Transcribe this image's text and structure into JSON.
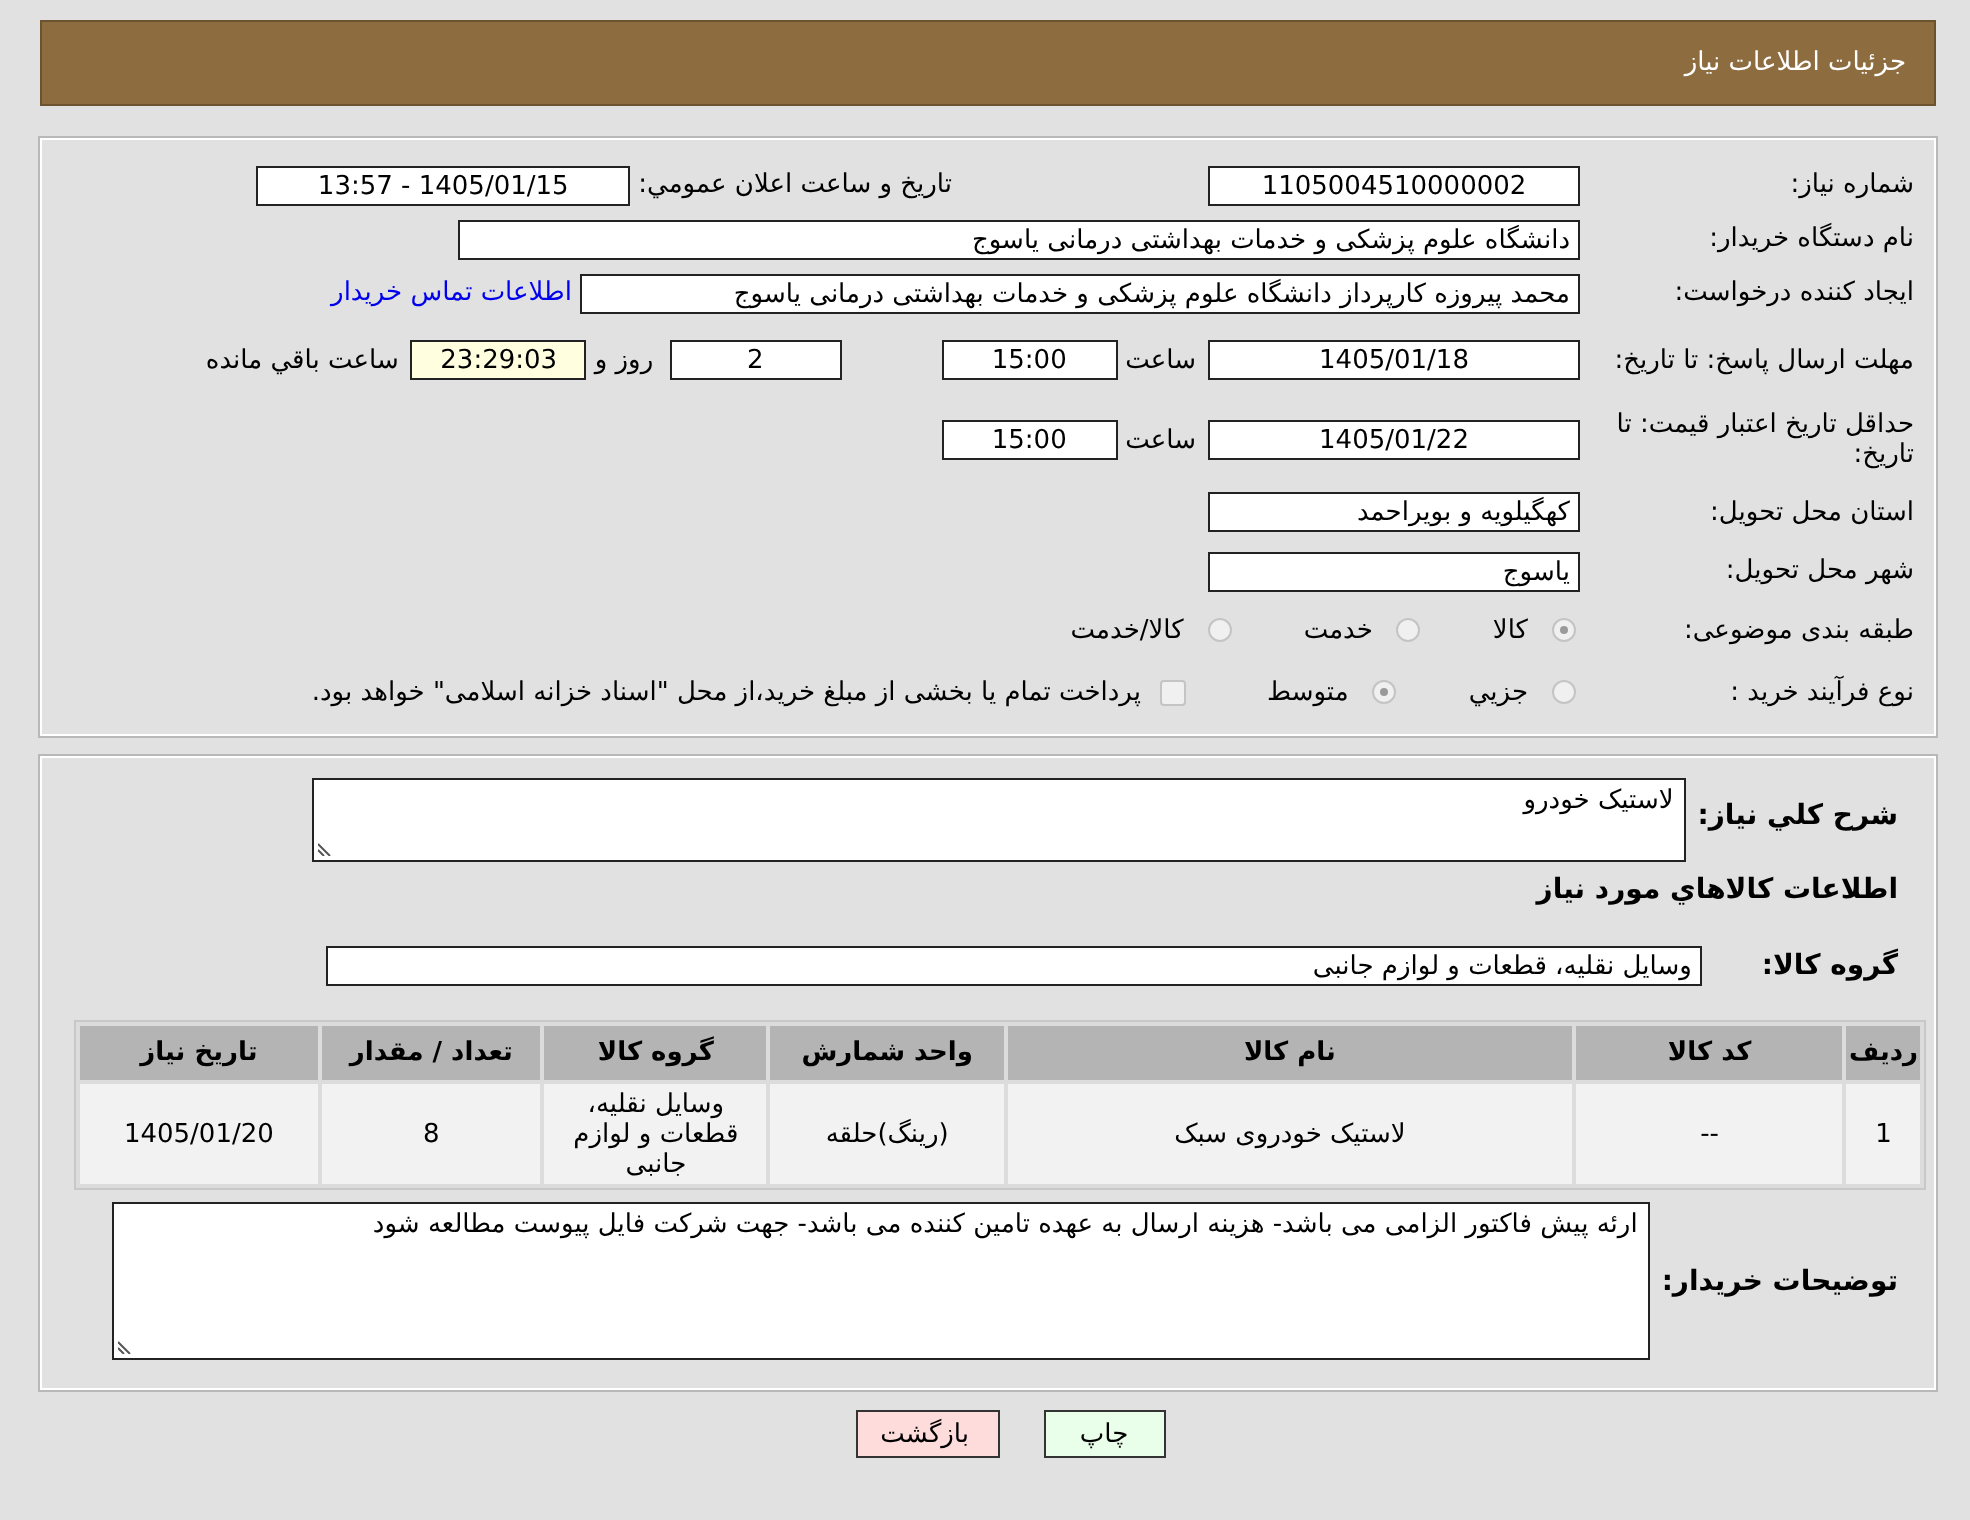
{
  "header": {
    "title": "جزئیات اطلاعات نیاز"
  },
  "need_number": {
    "label": "شماره نیاز:",
    "value": "1105004510000002"
  },
  "announce": {
    "label": "تاریخ و ساعت اعلان عمومي:",
    "value": "1405/01/15 - 13:57"
  },
  "buyer": {
    "label": "نام دستگاه خریدار:",
    "value": "دانشگاه علوم پزشکی و خدمات بهداشتی  درمانی یاسوج"
  },
  "requester": {
    "label": "ایجاد کننده درخواست:",
    "value": "محمد پیروزه کارپرداز دانشگاه علوم پزشکی و خدمات بهداشتی  درمانی یاسوج",
    "link": "اطلاعات تماس خریدار"
  },
  "reply_deadline": {
    "label": "مهلت ارسال پاسخ: تا تاریخ:",
    "date": "1405/01/18",
    "time_label": "ساعت",
    "time": "15:00",
    "days": "2",
    "days_label": "روز و",
    "remaining": "23:29:03",
    "remaining_label": "ساعت باقي مانده"
  },
  "price_validity": {
    "label": "حداقل تاریخ اعتبار قیمت: تا تاریخ:",
    "date": "1405/01/22",
    "time_label": "ساعت",
    "time": "15:00"
  },
  "province": {
    "label": "استان محل تحویل:",
    "value": "کهگیلویه و بویراحمد"
  },
  "city": {
    "label": "شهر محل تحویل:",
    "value": "یاسوج"
  },
  "category": {
    "label": "طبقه بندی موضوعی:",
    "options": [
      {
        "label": "کالا",
        "selected": true
      },
      {
        "label": "خدمت",
        "selected": false
      },
      {
        "label": "کالا/خدمت",
        "selected": false
      }
    ]
  },
  "process": {
    "label": "نوع فرآیند خرید :",
    "options": [
      {
        "label": "جزيي",
        "selected": false
      },
      {
        "label": "متوسط",
        "selected": true
      }
    ],
    "payment": {
      "label": "پرداخت تمام یا بخشی از مبلغ خرید،از محل \"اسناد خزانه اسلامی\" خواهد بود.",
      "checked": false
    }
  },
  "description": {
    "label": "شرح كلي نياز:",
    "value": "لاستیک خودرو"
  },
  "goods_title": "اطلاعات كالاهاي مورد نياز",
  "goods_group": {
    "label": "گروه کالا:",
    "value": "وسایل نقلیه، قطعات و لوازم جانبی"
  },
  "table": {
    "columns": [
      "ردیف",
      "کد کالا",
      "نام کالا",
      "واحد شمارش",
      "گروه کالا",
      "تعداد / مقدار",
      "تاریخ نیاز"
    ],
    "rows": [
      [
        "1",
        "--",
        "لاستیک خودروی سبک",
        "(رینگ)حلقه",
        "وسایل نقلیه، قطعات و لوازم جانبی",
        "8",
        "1405/01/20"
      ]
    ]
  },
  "buyer_notes": {
    "label": "توضیحات خریدار:",
    "value": "ارئه پیش فاکتور الزامی می باشد- هزینه ارسال به عهده تامین کننده می باشد- جهت شرکت فایل پیوست مطالعه شود"
  },
  "buttons": [
    {
      "label": "چاپ",
      "kind": "print"
    },
    {
      "label": "بازگشت",
      "kind": "back"
    }
  ]
}
